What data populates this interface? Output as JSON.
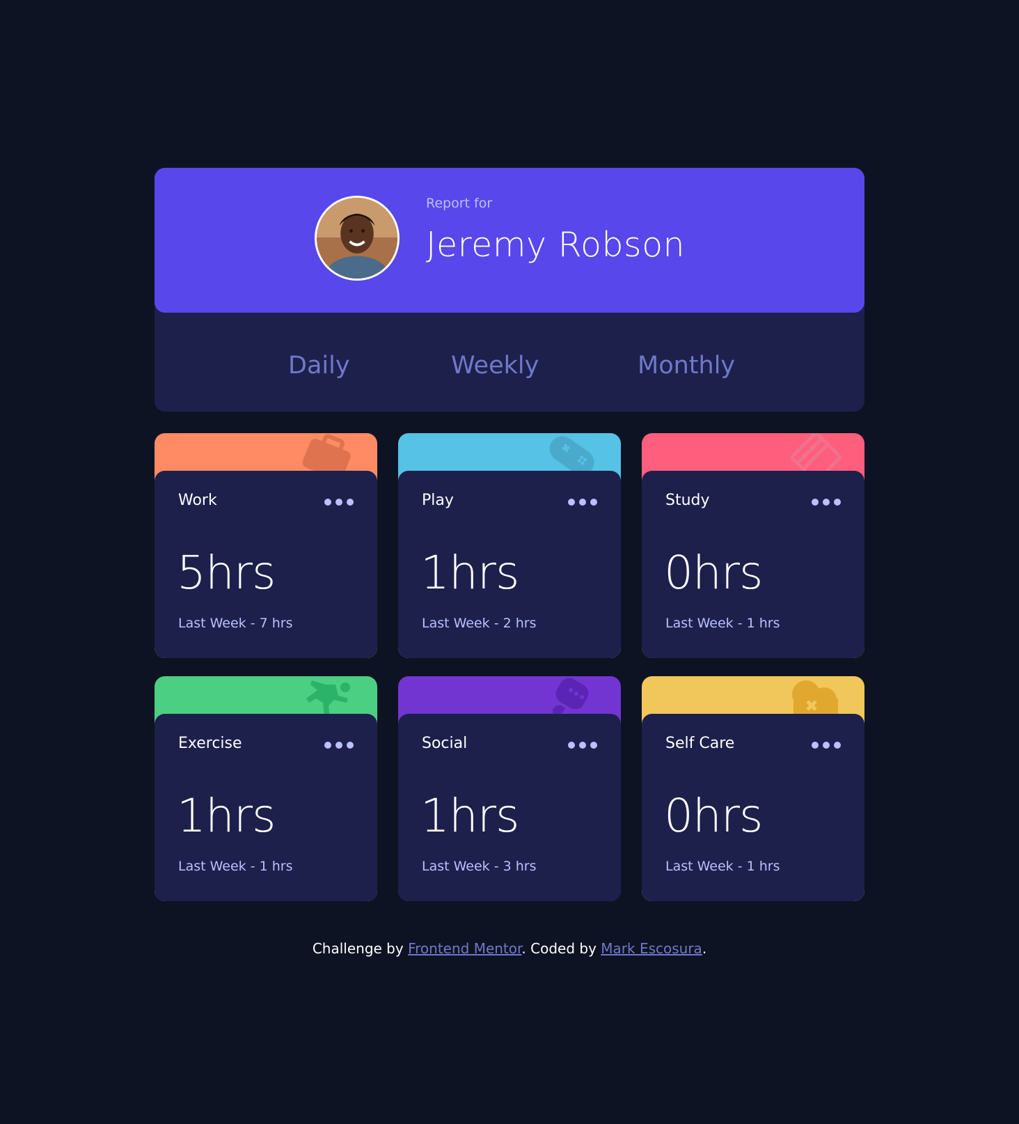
{
  "profile": {
    "report_label": "Report for",
    "name": "Jeremy Robson"
  },
  "tabs": [
    {
      "label": "Daily"
    },
    {
      "label": "Weekly"
    },
    {
      "label": "Monthly"
    }
  ],
  "activities": [
    {
      "title": "Work",
      "current": "5hrs",
      "previous": "Last Week - 7 hrs",
      "color": "#ff8b64",
      "icon": "briefcase-icon"
    },
    {
      "title": "Play",
      "current": "1hrs",
      "previous": "Last Week - 2 hrs",
      "color": "#55c2e6",
      "icon": "gamepad-icon"
    },
    {
      "title": "Study",
      "current": "0hrs",
      "previous": "Last Week - 1 hrs",
      "color": "#ff5e7d",
      "icon": "book-icon"
    },
    {
      "title": "Exercise",
      "current": "1hrs",
      "previous": "Last Week - 1 hrs",
      "color": "#4bcf82",
      "icon": "running-figure-icon"
    },
    {
      "title": "Social",
      "current": "1hrs",
      "previous": "Last Week - 3 hrs",
      "color": "#7335d2",
      "icon": "chat-bubble-icon"
    },
    {
      "title": "Self Care",
      "current": "0hrs",
      "previous": "Last Week - 1 hrs",
      "color": "#f1c75b",
      "icon": "heart-icon"
    }
  ],
  "footer": {
    "challenge_prefix": "Challenge by",
    "challenge_link": "Frontend Mentor",
    "coded_prefix": ". Coded by",
    "coded_link": "Mark Escosura",
    "suffix": "."
  },
  "colors": {
    "background": "#0e1323",
    "card": "#1c204b",
    "profile": "#5847eb",
    "muted_text": "#bbc0ff",
    "tab_text": "#7078c9"
  }
}
